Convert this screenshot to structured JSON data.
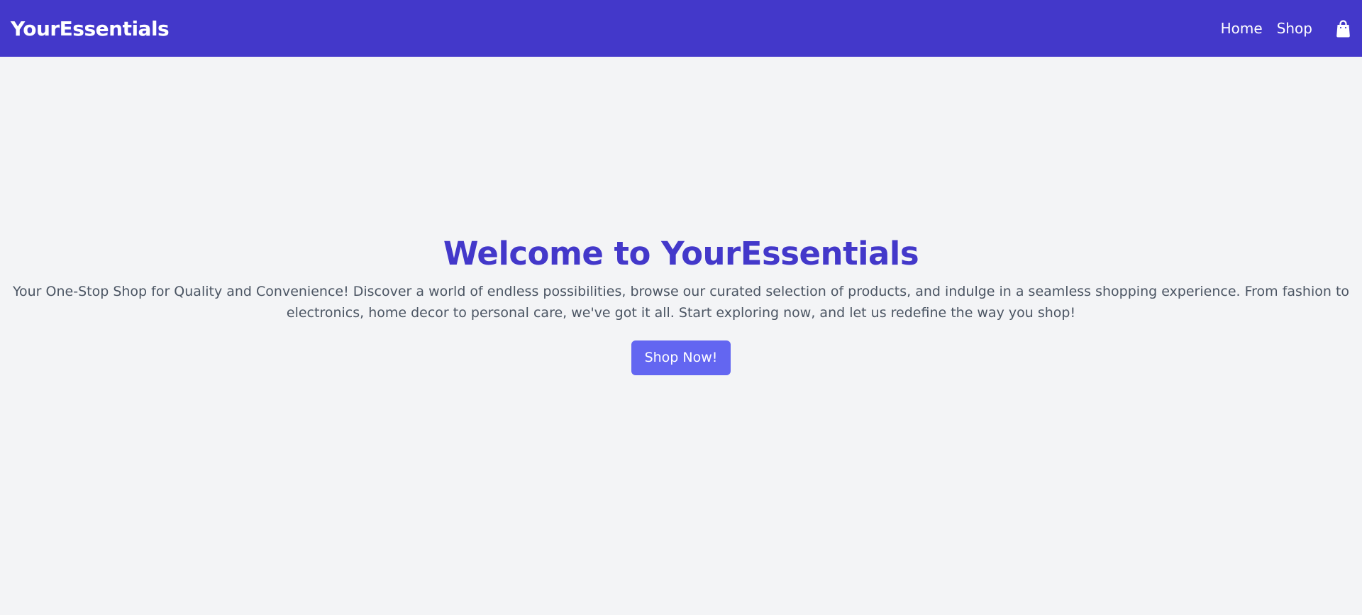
{
  "header": {
    "brand": "YourEssentials",
    "nav": {
      "home": "Home",
      "shop": "Shop"
    },
    "cart_icon": "shopping-bag-icon",
    "background_color": "#4338ca"
  },
  "hero": {
    "title": "Welcome to YourEssentials",
    "description": "Your One-Stop Shop for Quality and Convenience! Discover a world of endless possibilities, browse our curated selection of products, and indulge in a seamless shopping experience. From fashion to electronics, home decor to personal care, we've got it all. Start exploring now, and let us redefine the way you shop!",
    "cta_label": "Shop Now!",
    "title_color": "#4338ca",
    "cta_color": "#6366f1"
  },
  "page": {
    "background_color": "#f3f4f6"
  }
}
